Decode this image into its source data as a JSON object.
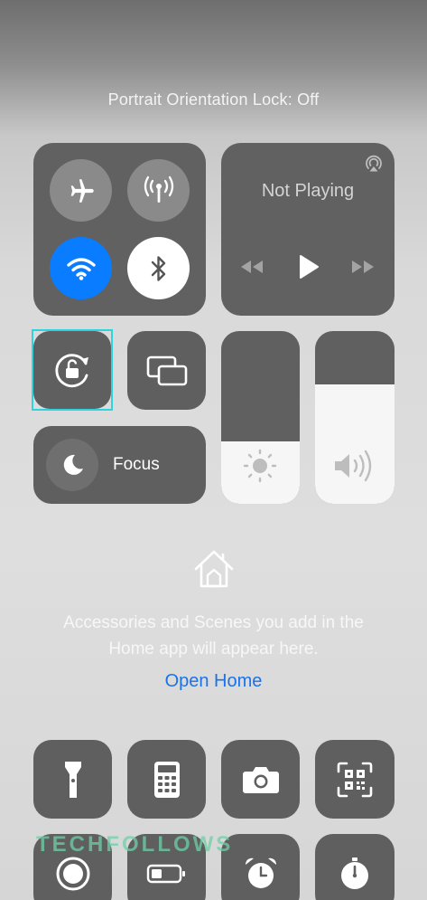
{
  "toast": {
    "text": "Portrait Orientation Lock: Off"
  },
  "connectivity": {
    "airplane": "airplane-icon",
    "cellular": "cellular-data-icon",
    "wifi": "wifi-icon",
    "bluetooth": "bluetooth-icon",
    "wifi_color": "#0a7cff"
  },
  "now_playing": {
    "status": "Not Playing",
    "airplay": "airplay-icon"
  },
  "controls": {
    "orientation_lock": "orientation-lock-icon",
    "screen_mirroring": "screen-mirroring-icon",
    "focus_label": "Focus"
  },
  "sliders": {
    "brightness_level": 0.36,
    "volume_level": 0.69
  },
  "home": {
    "line1": "Accessories and Scenes you add in the",
    "line2": "Home app will appear here.",
    "open_home": "Open Home"
  },
  "bottom_tiles": [
    "flashlight-icon",
    "calculator-icon",
    "camera-icon",
    "qr-code-icon",
    "screen-record-icon",
    "low-power-icon",
    "alarm-icon",
    "timer-icon"
  ],
  "watermark": "TECHFOLLOWS"
}
